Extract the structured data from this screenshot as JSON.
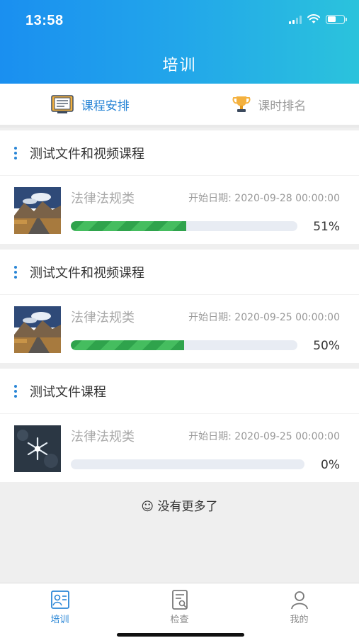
{
  "status_bar": {
    "time": "13:58"
  },
  "header": {
    "title": "培训"
  },
  "tabs": [
    {
      "label": "课程安排",
      "icon": "schedule-doc-icon",
      "active": true
    },
    {
      "label": "课时排名",
      "icon": "trophy-icon",
      "active": false
    }
  ],
  "courses": [
    {
      "title": "测试文件和视频课程",
      "category": "法律法规类",
      "start_date": "开始日期: 2020-09-28 00:00:00",
      "progress": 51,
      "progress_label": "51%",
      "thumbnail": "mountain-road"
    },
    {
      "title": "测试文件和视频课程",
      "category": "法律法规类",
      "start_date": "开始日期: 2020-09-25 00:00:00",
      "progress": 50,
      "progress_label": "50%",
      "thumbnail": "mountain-road"
    },
    {
      "title": "测试文件课程",
      "category": "法律法规类",
      "start_date": "开始日期: 2020-09-25 00:00:00",
      "progress": 0,
      "progress_label": "0%",
      "thumbnail": "snowflake"
    }
  ],
  "footer_message": "☺ 没有更多了",
  "bottom_nav": [
    {
      "label": "培训",
      "icon": "training-icon",
      "active": true
    },
    {
      "label": "检查",
      "icon": "inspection-icon",
      "active": false
    },
    {
      "label": "我的",
      "icon": "profile-icon",
      "active": false
    }
  ],
  "colors": {
    "accent": "#2a86d6",
    "progress": "#2fa34c",
    "header_start": "#1a8ff0",
    "header_end": "#2bc3dc"
  }
}
